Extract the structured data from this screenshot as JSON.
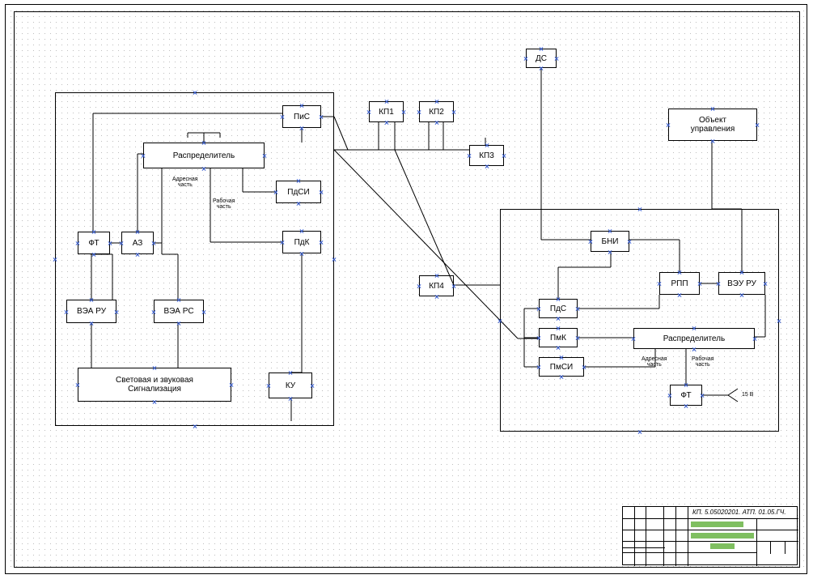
{
  "blocks": {
    "pis": "ПиС",
    "raspred1": "Распределитель",
    "pdsi": "ПдСИ",
    "pdk": "ПдК",
    "ft1": "ФТ",
    "az": "АЗ",
    "vea_ru": "ВЭА РУ",
    "vea_rs": "ВЭА РС",
    "signal": "Световая и звуковая\nСигнализация",
    "ku": "КУ",
    "kp1": "КП1",
    "kp2": "КП2",
    "kp3": "КП3",
    "kp4": "КП4",
    "ds": "ДС",
    "obj": "Объект\nуправления",
    "bni": "БНИ",
    "rpp": "РПП",
    "veu_ru": "ВЭУ РУ",
    "pds2": "ПдС",
    "pmk": "ПмК",
    "pmsi": "ПмСИ",
    "raspred2": "Распределитель",
    "ft2": "ФТ"
  },
  "labels": {
    "addr1": "Адресная\nчасть",
    "work1": "Рабочая\nчасть",
    "addr2": "Адресная\nчасть",
    "work2": "Рабочая\nчасть",
    "v15": "15 В"
  },
  "titleblock": {
    "code": "КП. 5.05020201. АТП. 01.05.ГЧ."
  }
}
